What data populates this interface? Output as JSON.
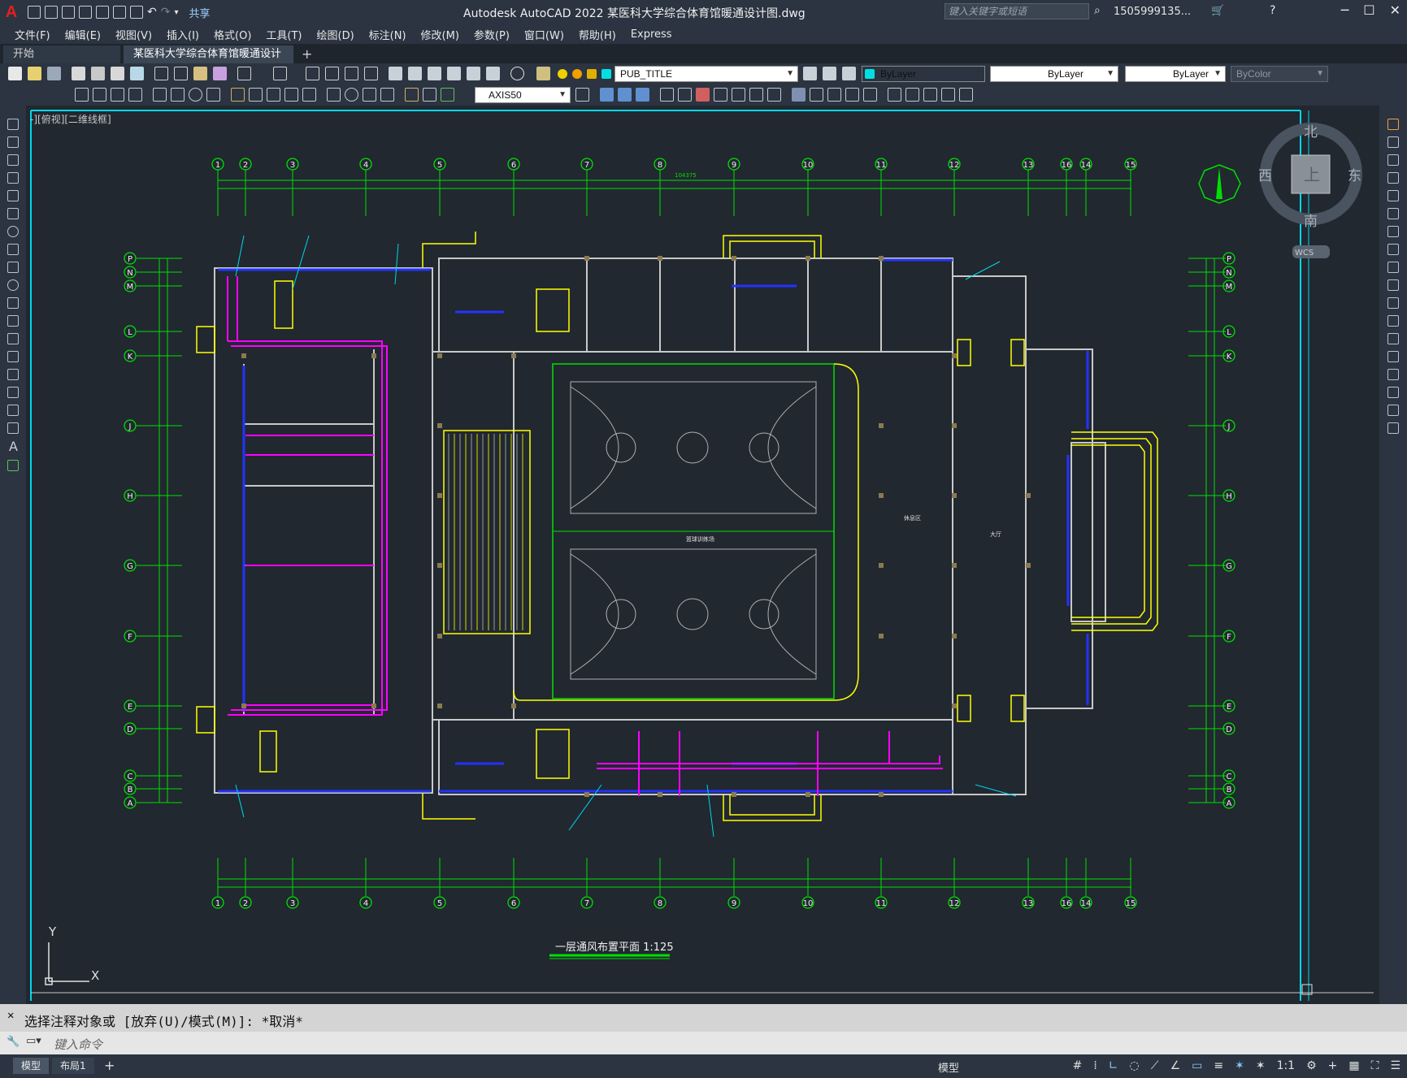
{
  "app": {
    "logo": "A",
    "title": "Autodesk AutoCAD 2022    某医科大学综合体育馆暖通设计图.dwg",
    "share": "共享",
    "search_placeholder": "键入关键字或短语",
    "user": "1505999135...",
    "window_controls": [
      "─",
      "☐",
      "✕"
    ]
  },
  "menu": [
    "文件(F)",
    "编辑(E)",
    "视图(V)",
    "插入(I)",
    "格式(O)",
    "工具(T)",
    "绘图(D)",
    "标注(N)",
    "修改(M)",
    "参数(P)",
    "窗口(W)",
    "帮助(H)",
    "Express"
  ],
  "tabs": [
    {
      "label": "开始"
    },
    {
      "label": "某医科大学综合体育馆暖通设计图*"
    }
  ],
  "toolbar": {
    "layer": "PUB_TITLE",
    "color": "ByLayer",
    "linetype": "ByLayer",
    "lineweight": "ByLayer",
    "plotstyle": "ByColor",
    "dimstyle": "AXIS50"
  },
  "viewport": {
    "label": "-][俯视][二维线框]",
    "viewcube": {
      "north": "北",
      "south": "南",
      "east": "东",
      "west": "西",
      "face": "上",
      "ucs": "WCS"
    }
  },
  "drawing": {
    "title": "一层通风布置平面  1:125",
    "grid_top": [
      "1",
      "2",
      "3",
      "4",
      "5",
      "6",
      "7",
      "8",
      "9",
      "10",
      "11",
      "12",
      "13",
      "16",
      "14",
      "15"
    ],
    "grid_left": [
      "P",
      "N",
      "M",
      "L",
      "K",
      "J",
      "H",
      "G",
      "F",
      "E",
      "D",
      "C",
      "B",
      "A"
    ],
    "room_gym": "篮球训练场",
    "room_lobby": "大厅",
    "room_rest": "休息区",
    "ucs_x": "X",
    "ucs_y": "Y",
    "dim_top_total": "104375"
  },
  "command": {
    "history": "选择注释对象或 [放弃(U)/模式(M)]: *取消*",
    "placeholder": "键入命令"
  },
  "status": {
    "tabs": [
      "模型",
      "布局1"
    ],
    "model_label": "模型",
    "scale": "1:1"
  },
  "colors": {
    "background": "#212830",
    "axis": "#00e000",
    "wall": "#c8c8c8",
    "duct": "#ff00ff",
    "window": "#2233ff",
    "stairs": "#ffff00",
    "frame": "#00d8e8"
  }
}
